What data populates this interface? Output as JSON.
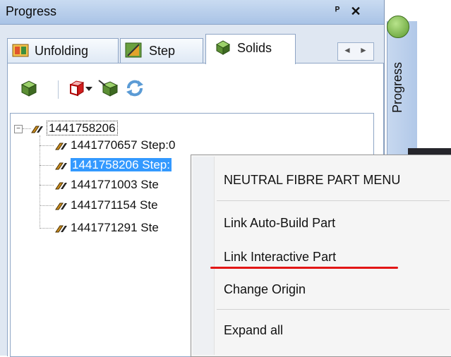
{
  "panel": {
    "title": "Progress"
  },
  "tabs": [
    {
      "label": "Unfolding",
      "icon": "unfolding-icon"
    },
    {
      "label": "Step",
      "icon": "step-icon"
    },
    {
      "label": "Solids",
      "icon": "solids-icon",
      "selected": true
    }
  ],
  "toolbar": {
    "buttons": [
      "solid-part-icon",
      "red-cube-icon",
      "dropdown-arrow-icon",
      "link-part-icon",
      "refresh-icon"
    ]
  },
  "tree": {
    "root": "1441758206",
    "children": [
      "1441770657 Step:0",
      "1441758206 Step:",
      "1441771003 Ste",
      "1441771154 Ste",
      "1441771291 Ste"
    ],
    "selected_index": 1
  },
  "side_panel": {
    "label": "Progress"
  },
  "context_menu": {
    "header": "NEUTRAL FIBRE PART MENU",
    "items": [
      "Link Auto-Build Part",
      "Link Interactive Part",
      "Change Origin",
      "Expand all"
    ],
    "highlight_color": "#e21616"
  },
  "colors": {
    "selection": "#3399ff",
    "panel": "#dfe7f2",
    "titlebar": "#a9c3e6"
  }
}
